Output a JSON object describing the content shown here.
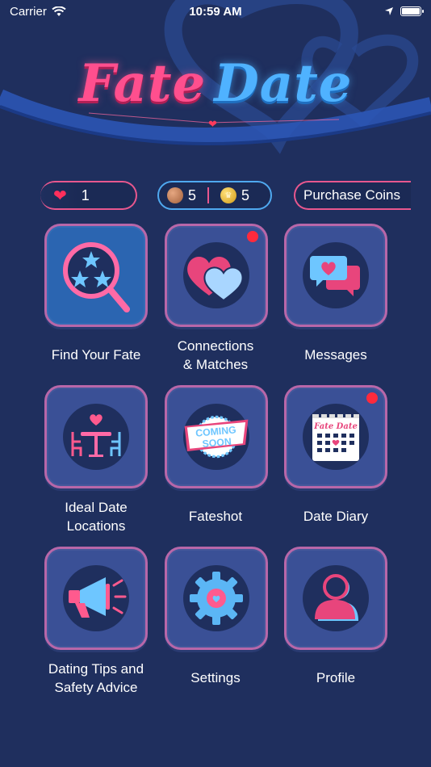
{
  "status_bar": {
    "carrier": "Carrier",
    "time": "10:59 AM"
  },
  "logo": {
    "part1": "Fate",
    "part2": "Date"
  },
  "stats": {
    "hearts": "1",
    "bronze_coins": "5",
    "gold_coins": "5",
    "purchase_label": "Purchase Coins"
  },
  "tiles": [
    {
      "label": "Find Your Fate",
      "icon": "search-stars-icon",
      "badge": false
    },
    {
      "label": "Connections\n& Matches",
      "icon": "hearts-icon",
      "badge": true
    },
    {
      "label": "Messages",
      "icon": "chat-bubbles-icon",
      "badge": false
    },
    {
      "label": "Ideal Date\nLocations",
      "icon": "date-table-icon",
      "badge": false
    },
    {
      "label": "Fateshot",
      "icon": "coming-soon-icon",
      "badge": false,
      "sticker": {
        "line1": "COMING",
        "line2": "SOON"
      }
    },
    {
      "label": "Date Diary",
      "icon": "calendar-icon",
      "badge": true,
      "calendar_title": "Fate Date"
    },
    {
      "label": "Dating Tips and\nSafety Advice",
      "icon": "megaphone-icon",
      "badge": false
    },
    {
      "label": "Settings",
      "icon": "gear-icon",
      "badge": false
    },
    {
      "label": "Profile",
      "icon": "profile-icon",
      "badge": false
    }
  ],
  "colors": {
    "background": "#1f2f5e",
    "tile": "#3a5096",
    "tile_border": "#b867a9",
    "pink": "#e8578e",
    "blue": "#4fa9f0",
    "badge": "#ff2a3c"
  }
}
